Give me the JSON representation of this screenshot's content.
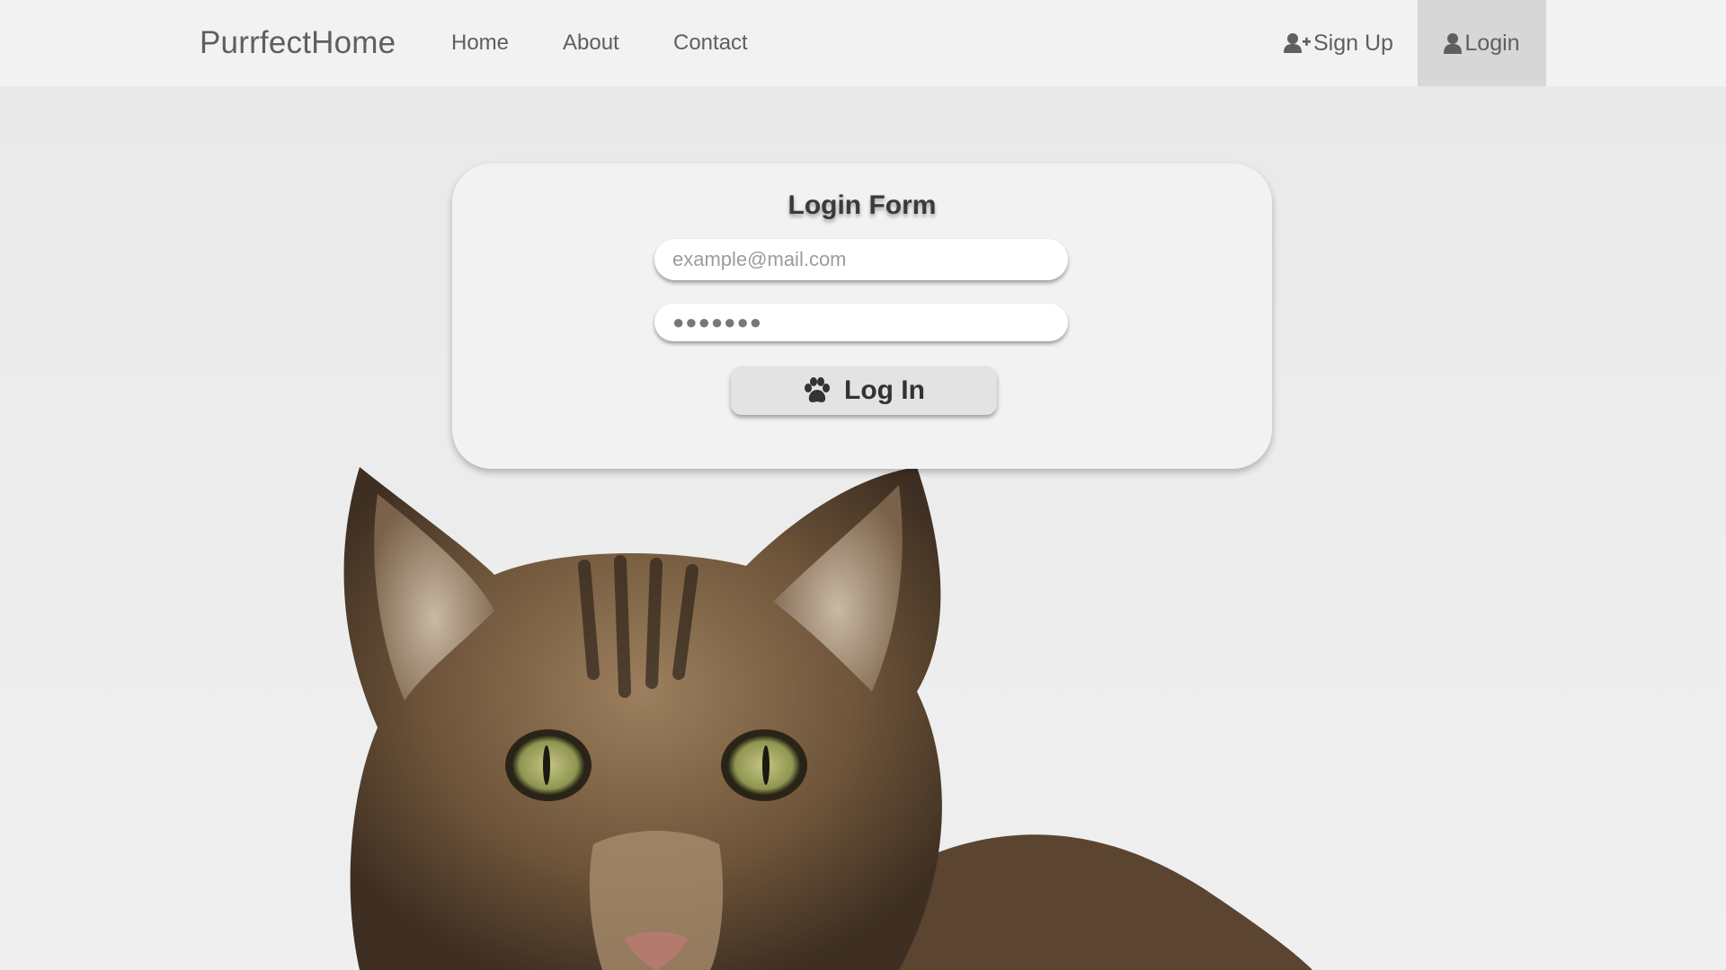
{
  "navbar": {
    "brand": "PurrfectHome",
    "links": [
      "Home",
      "About",
      "Contact"
    ],
    "signup_label": "Sign Up",
    "login_label": "Login",
    "signup_icon": "user-plus-icon",
    "login_icon": "user-icon"
  },
  "login_form": {
    "title": "Login Form",
    "email_placeholder": "example@mail.com",
    "password_value": "●●●●●●●",
    "submit_label": "Log In",
    "submit_icon": "paw-icon"
  },
  "colors": {
    "navbar_bg": "#f2f2f2",
    "active_nav_bg": "#d7d7d7",
    "text": "#5f5f5f",
    "card_bg": "#f1f1f1"
  }
}
